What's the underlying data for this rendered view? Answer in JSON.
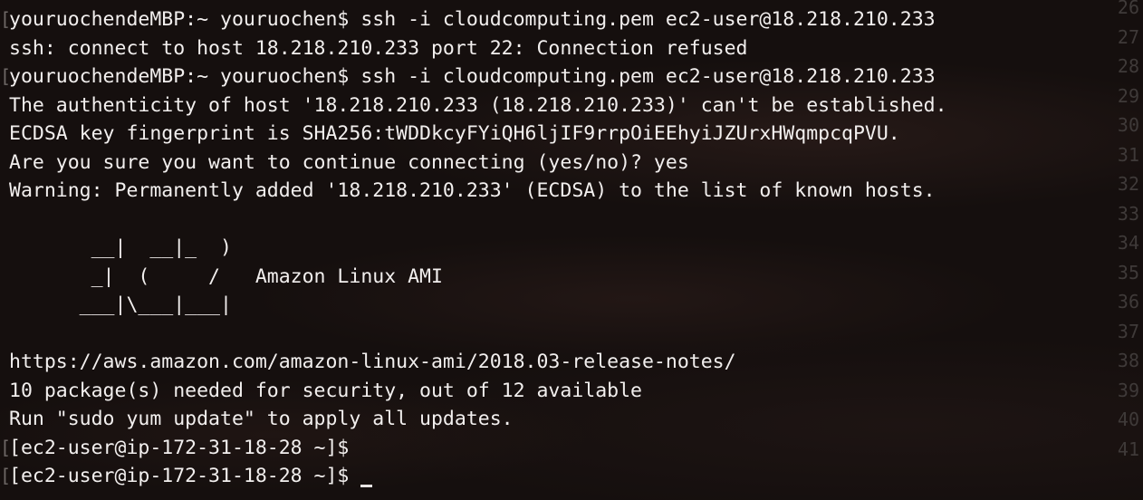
{
  "terminal": {
    "lines": [
      {
        "bracket": "[",
        "text": "youruochendeMBP:~ youruochen$ ssh -i cloudcomputing.pem ec2-user@18.218.210.233"
      },
      {
        "bracket": "",
        "text": "ssh: connect to host 18.218.210.233 port 22: Connection refused"
      },
      {
        "bracket": "[",
        "text": "youruochendeMBP:~ youruochen$ ssh -i cloudcomputing.pem ec2-user@18.218.210.233"
      },
      {
        "bracket": "",
        "text": "The authenticity of host '18.218.210.233 (18.218.210.233)' can't be established."
      },
      {
        "bracket": "",
        "text": "ECDSA key fingerprint is SHA256:tWDDkcyFYiQH6ljIF9rrpOiEEhyiJZUrxHWqmpcqPVU."
      },
      {
        "bracket": "",
        "text": "Are you sure you want to continue connecting (yes/no)? yes"
      },
      {
        "bracket": "",
        "text": "Warning: Permanently added '18.218.210.233' (ECDSA) to the list of known hosts."
      },
      {
        "bracket": "",
        "text": ""
      },
      {
        "bracket": "",
        "text": "       __|  __|_  )"
      },
      {
        "bracket": "",
        "text": "       _|  (     /   Amazon Linux AMI"
      },
      {
        "bracket": "",
        "text": "      ___|\\___|___|"
      },
      {
        "bracket": "",
        "text": ""
      },
      {
        "bracket": "",
        "text": "https://aws.amazon.com/amazon-linux-ami/2018.03-release-notes/"
      },
      {
        "bracket": "",
        "text": "10 package(s) needed for security, out of 12 available"
      },
      {
        "bracket": "",
        "text": "Run \"sudo yum update\" to apply all updates."
      },
      {
        "bracket": "[",
        "text": "[ec2-user@ip-172-31-18-28 ~]$"
      },
      {
        "bracket": "[",
        "text": "[ec2-user@ip-172-31-18-28 ~]$"
      }
    ],
    "line_numbers": [
      "26",
      "27",
      "28",
      "29",
      "30",
      "31",
      "32",
      "33",
      "34",
      "35",
      "36",
      "37",
      "38",
      "39",
      "40",
      "41"
    ]
  },
  "colors": {
    "text": "#f2efee",
    "background": "#150f0e",
    "gutter": "#3f3a39"
  }
}
